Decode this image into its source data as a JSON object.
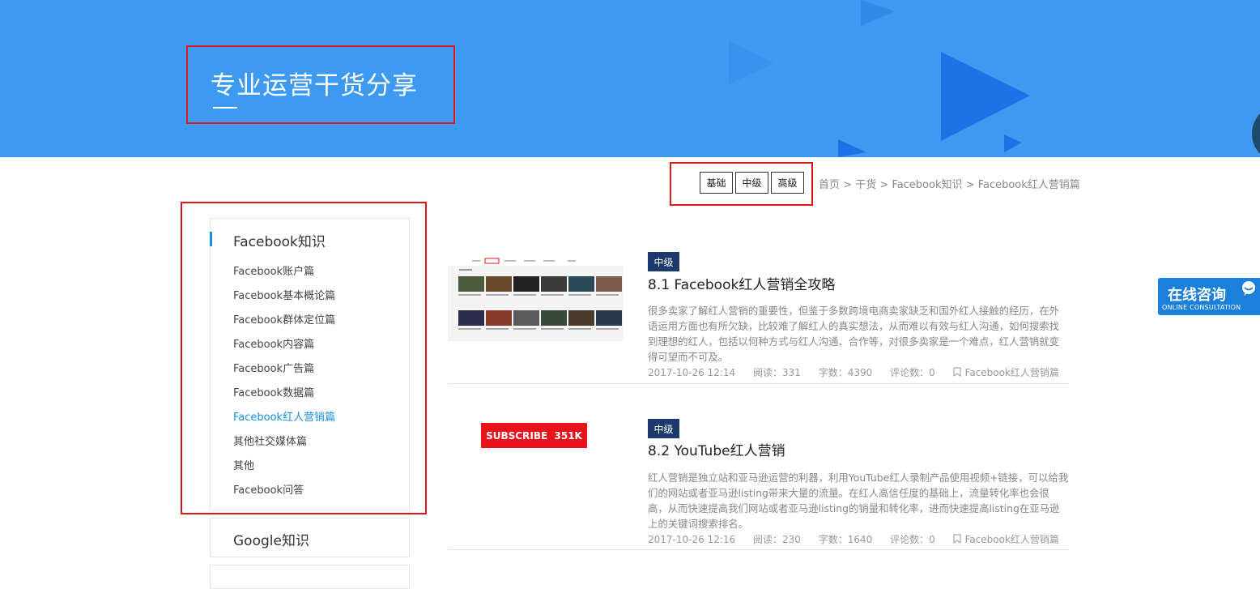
{
  "banner": {
    "title": "专业运营干货分享"
  },
  "levels": {
    "basic": "基础",
    "mid": "中级",
    "high": "高级"
  },
  "breadcrumb": {
    "home": "首页",
    "sep": ">",
    "l1": "干货",
    "l2": "Facebook知识",
    "l3": "Facebook红人营销篇"
  },
  "sidebar": {
    "heading": "Facebook知识",
    "items": [
      "Facebook账户篇",
      "Facebook基本概论篇",
      "Facebook群体定位篇",
      "Facebook内容篇",
      "Facebook广告篇",
      "Facebook数据篇",
      "Facebook红人营销篇",
      "其他社交媒体篇",
      "其他",
      "Facebook问答"
    ],
    "heading2": "Google知识"
  },
  "articles": [
    {
      "tag": "中级",
      "title": "8.1 Facebook红人营销全攻略",
      "desc": "很多卖家了解红人营销的重要性，但鉴于多数跨境电商卖家缺乏和国外红人接触的经历，在外语运用方面也有所欠缺，比较难了解红人的真实想法，从而难以有效与红人沟通，如何搜索找到理想的红人，包括以何种方式与红人沟通、合作等，对很多卖家是一个难点，红人营销就变得可望而不可及。",
      "date": "2017-10-26 12:14",
      "reads": "阅读：331",
      "words": "字数：4390",
      "comments": "评论数：0",
      "category": "Facebook红人营销篇"
    },
    {
      "tag": "中级",
      "title": "8.2 YouTube红人营销",
      "desc": "红人营销是独立站和亚马逊运营的利器，利用YouTube红人录制产品使用视频+链接，可以给我们的网站或者亚马逊listing带来大量的流量。在红人高信任度的基础上，流量转化率也会很高，从而快速提高我们网站或者亚马逊listing的销量和转化率，进而快速提高listing在亚马逊上的关键词搜索排名。",
      "date": "2017-10-26 12:16",
      "reads": "阅读：230",
      "words": "字数：1640",
      "comments": "评论数：0",
      "category": "Facebook红人营销篇",
      "thumb_text": "SUBSCRIBE  351K"
    }
  ],
  "consult": {
    "title": "在线咨询",
    "subtitle": "ONLINE CONSULTATION"
  },
  "colors": {
    "banner": "#3d9af0",
    "accent": "#1a8ee0",
    "tag": "#1d3a6e",
    "highlight": "#e0161c"
  }
}
